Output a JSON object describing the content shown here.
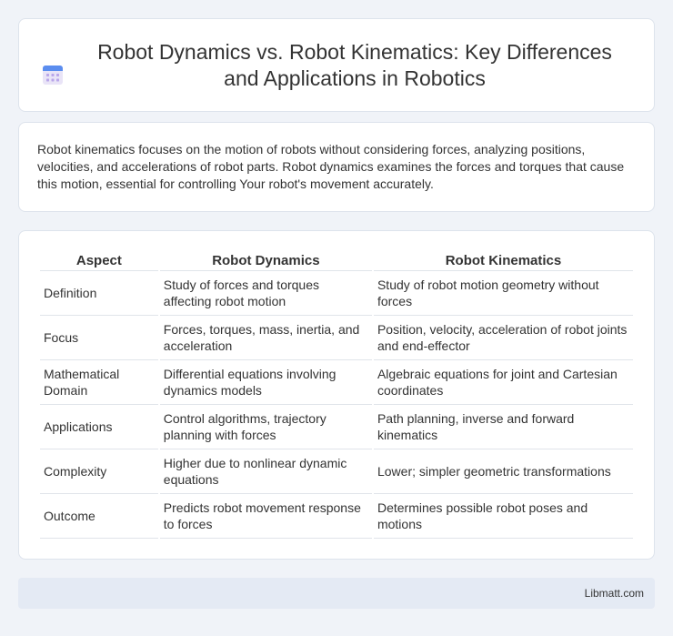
{
  "header": {
    "icon": "calendar-icon",
    "title": "Robot Dynamics vs. Robot Kinematics: Key Differences and Applications in Robotics"
  },
  "intro": {
    "text": "Robot kinematics focuses on the motion of robots without considering forces, analyzing positions, velocities, and accelerations of robot parts. Robot dynamics examines the forces and torques that cause this motion, essential for controlling Your robot's movement accurately."
  },
  "table": {
    "headers": [
      "Aspect",
      "Robot Dynamics",
      "Robot Kinematics"
    ],
    "rows": [
      [
        "Definition",
        "Study of forces and torques affecting robot motion",
        "Study of robot motion geometry without forces"
      ],
      [
        "Focus",
        "Forces, torques, mass, inertia, and acceleration",
        "Position, velocity, acceleration of robot joints and end-effector"
      ],
      [
        "Mathematical Domain",
        "Differential equations involving dynamics models",
        "Algebraic equations for joint and Cartesian coordinates"
      ],
      [
        "Applications",
        "Control algorithms, trajectory planning with forces",
        "Path planning, inverse and forward kinematics"
      ],
      [
        "Complexity",
        "Higher due to nonlinear dynamic equations",
        "Lower; simpler geometric transformations"
      ],
      [
        "Outcome",
        "Predicts robot movement response to forces",
        "Determines possible robot poses and motions"
      ]
    ]
  },
  "footer": {
    "text": "Libmatt.com"
  }
}
